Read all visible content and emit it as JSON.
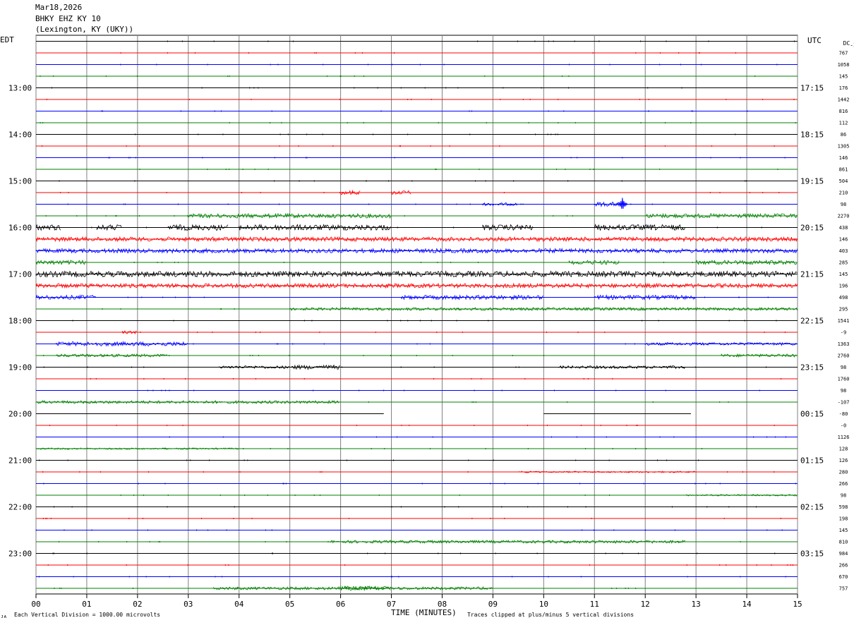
{
  "header": {
    "date": "Mar18,2026",
    "station": "BHKY EHZ KY 10",
    "location": "(Lexington, KY (UKY))"
  },
  "left_axis_title": "EDT",
  "right_axis_title": "UTC",
  "dc_label": "DC",
  "dc_sub": "-2",
  "bottom": {
    "xlabel": "TIME (MINUTES)",
    "left_note": "Each Vertical Division = 1000.00 microvolts",
    "right_note": "Traces clipped at plus/minus 5 vertical divisions",
    "corner_mark": "ᴊᴀ"
  },
  "colors": {
    "black": "#000000",
    "red": "#ff0000",
    "blue": "#0000ff",
    "green": "#008000",
    "grid": "#808080",
    "minor_grid": "#8080c0"
  },
  "chart_data": {
    "type": "line",
    "title": "BHKY EHZ KY 10",
    "xlabel": "TIME (MINUTES)",
    "xlim": [
      0,
      15
    ],
    "x_ticks": [
      "00",
      "01",
      "02",
      "03",
      "04",
      "05",
      "06",
      "07",
      "08",
      "09",
      "10",
      "11",
      "12",
      "13",
      "14",
      "15"
    ],
    "trace_colors": [
      "black",
      "red",
      "blue",
      "green"
    ],
    "left_hour_labels": [
      {
        "row": 4,
        "text": "13:00"
      },
      {
        "row": 8,
        "text": "14:00"
      },
      {
        "row": 12,
        "text": "15:00"
      },
      {
        "row": 16,
        "text": "16:00"
      },
      {
        "row": 20,
        "text": "17:00"
      },
      {
        "row": 24,
        "text": "18:00"
      },
      {
        "row": 28,
        "text": "19:00"
      },
      {
        "row": 32,
        "text": "20:00"
      },
      {
        "row": 36,
        "text": "21:00"
      },
      {
        "row": 40,
        "text": "22:00"
      },
      {
        "row": 44,
        "text": "23:00"
      }
    ],
    "right_hour_labels": [
      {
        "row": 4,
        "text": "17:15"
      },
      {
        "row": 8,
        "text": "18:15"
      },
      {
        "row": 12,
        "text": "19:15"
      },
      {
        "row": 16,
        "text": "20:15"
      },
      {
        "row": 20,
        "text": "21:15"
      },
      {
        "row": 24,
        "text": "22:15"
      },
      {
        "row": 28,
        "text": "23:15"
      },
      {
        "row": 32,
        "text": "00:15"
      },
      {
        "row": 36,
        "text": "01:15"
      },
      {
        "row": 40,
        "text": "02:15"
      },
      {
        "row": 44,
        "text": "03:15"
      }
    ],
    "dc_offsets": [
      "767",
      "1058",
      "145",
      "176",
      "1442",
      "816",
      "112",
      "86",
      "1305",
      "146",
      "861",
      "504",
      "210",
      "98",
      "2270",
      "438",
      "146",
      "403",
      "285",
      "145",
      "196",
      "498",
      "295",
      "1541",
      "-9",
      "1363",
      "2760",
      "98",
      "1760",
      "98",
      "-107",
      "-80",
      "-0",
      "1126",
      "128",
      "126",
      "280",
      "266",
      "98",
      "598",
      "198",
      "145",
      "810",
      "984",
      "266",
      "670",
      "757"
    ],
    "traces": [
      {
        "row": 0,
        "color": "black",
        "activity": []
      },
      {
        "row": 1,
        "color": "red",
        "activity": []
      },
      {
        "row": 2,
        "color": "blue",
        "activity": []
      },
      {
        "row": 3,
        "color": "green",
        "activity": []
      },
      {
        "row": 4,
        "color": "black",
        "activity": []
      },
      {
        "row": 5,
        "color": "red",
        "activity": []
      },
      {
        "row": 6,
        "color": "blue",
        "activity": []
      },
      {
        "row": 7,
        "color": "green",
        "activity": []
      },
      {
        "row": 8,
        "color": "black",
        "activity": []
      },
      {
        "row": 9,
        "color": "red",
        "activity": []
      },
      {
        "row": 10,
        "color": "blue",
        "activity": []
      },
      {
        "row": 11,
        "color": "green",
        "activity": []
      },
      {
        "row": 12,
        "color": "black",
        "activity": []
      },
      {
        "row": 13,
        "color": "red",
        "activity": [
          [
            6.0,
            6.4,
            3
          ],
          [
            7.0,
            7.4,
            3
          ]
        ]
      },
      {
        "row": 14,
        "color": "blue",
        "activity": [
          [
            8.8,
            9.5,
            2
          ],
          [
            11.0,
            11.6,
            3
          ]
        ],
        "event": {
          "x": 11.55,
          "amp": 9
        }
      },
      {
        "row": 15,
        "color": "green",
        "activity": [
          [
            3.0,
            7.0,
            3
          ],
          [
            12.0,
            15.0,
            3
          ]
        ]
      },
      {
        "row": 16,
        "color": "black",
        "activity": [
          [
            0.0,
            0.5,
            4
          ],
          [
            1.2,
            1.7,
            4
          ],
          [
            2.6,
            3.8,
            4
          ],
          [
            4.0,
            7.0,
            4
          ],
          [
            8.8,
            9.8,
            4
          ],
          [
            11.0,
            12.8,
            4
          ]
        ]
      },
      {
        "row": 17,
        "color": "red",
        "activity": [
          [
            0.0,
            15.0,
            3
          ]
        ]
      },
      {
        "row": 18,
        "color": "blue",
        "activity": [
          [
            0.0,
            15.0,
            3
          ]
        ]
      },
      {
        "row": 19,
        "color": "green",
        "activity": [
          [
            0.0,
            1.0,
            3
          ],
          [
            10.5,
            11.5,
            3
          ],
          [
            13.0,
            15.0,
            3
          ]
        ]
      },
      {
        "row": 20,
        "color": "black",
        "activity": [
          [
            0.0,
            15.0,
            4
          ]
        ]
      },
      {
        "row": 21,
        "color": "red",
        "activity": [
          [
            0.0,
            15.0,
            3
          ]
        ]
      },
      {
        "row": 22,
        "color": "blue",
        "activity": [
          [
            0.0,
            1.2,
            3
          ],
          [
            7.2,
            10.0,
            3
          ],
          [
            11.0,
            13.0,
            3
          ]
        ]
      },
      {
        "row": 23,
        "color": "green",
        "activity": [
          [
            5.0,
            15.0,
            2
          ]
        ]
      },
      {
        "row": 24,
        "color": "black",
        "activity": []
      },
      {
        "row": 25,
        "color": "red",
        "activity": [
          [
            1.7,
            2.0,
            2
          ]
        ]
      },
      {
        "row": 26,
        "color": "blue",
        "activity": [
          [
            0.4,
            3.0,
            3
          ],
          [
            12.0,
            15.0,
            2
          ]
        ]
      },
      {
        "row": 27,
        "color": "green",
        "activity": [
          [
            0.4,
            2.6,
            2
          ],
          [
            13.5,
            15.0,
            2
          ]
        ]
      },
      {
        "row": 28,
        "color": "black",
        "activity": [
          [
            3.6,
            5.0,
            2
          ],
          [
            5.0,
            6.0,
            3
          ],
          [
            10.3,
            12.8,
            2
          ]
        ]
      },
      {
        "row": 29,
        "color": "red",
        "activity": []
      },
      {
        "row": 30,
        "color": "blue",
        "activity": []
      },
      {
        "row": 31,
        "color": "green",
        "activity": [
          [
            0.0,
            6.0,
            2
          ]
        ]
      },
      {
        "row": 32,
        "color": "black",
        "activity": [],
        "flat_segments": [
          [
            0.0,
            6.85
          ],
          [
            10.0,
            12.9
          ]
        ]
      },
      {
        "row": 33,
        "color": "red",
        "activity": []
      },
      {
        "row": 34,
        "color": "blue",
        "activity": []
      },
      {
        "row": 35,
        "color": "green",
        "activity": [
          [
            0.0,
            4.0,
            1
          ]
        ]
      },
      {
        "row": 36,
        "color": "black",
        "activity": []
      },
      {
        "row": 37,
        "color": "red",
        "activity": [
          [
            9.5,
            13.0,
            1
          ]
        ]
      },
      {
        "row": 38,
        "color": "blue",
        "activity": []
      },
      {
        "row": 39,
        "color": "green",
        "activity": [
          [
            12.8,
            15.0,
            1
          ]
        ]
      },
      {
        "row": 40,
        "color": "black",
        "activity": []
      },
      {
        "row": 41,
        "color": "red",
        "activity": []
      },
      {
        "row": 42,
        "color": "blue",
        "activity": []
      },
      {
        "row": 43,
        "color": "green",
        "activity": [
          [
            5.8,
            12.8,
            2
          ]
        ]
      },
      {
        "row": 44,
        "color": "black",
        "activity": []
      },
      {
        "row": 45,
        "color": "red",
        "activity": []
      },
      {
        "row": 46,
        "color": "blue",
        "activity": []
      },
      {
        "row": 47,
        "color": "green",
        "activity": [
          [
            3.5,
            9.0,
            2
          ],
          [
            6.0,
            7.0,
            3
          ]
        ]
      }
    ]
  }
}
